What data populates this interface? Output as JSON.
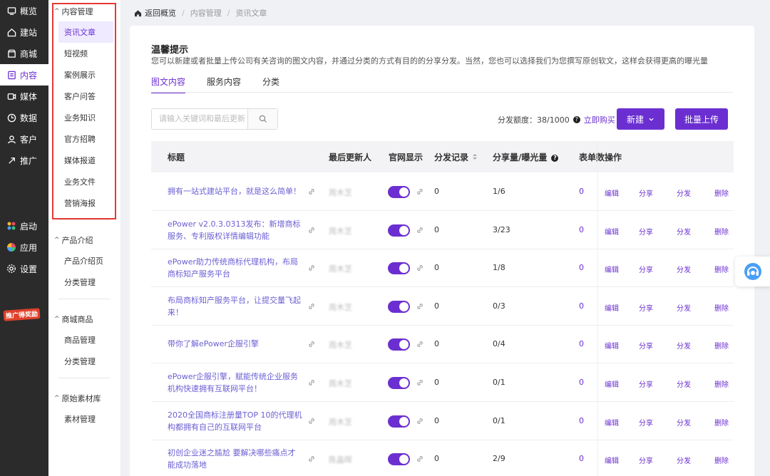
{
  "nav": {
    "items": [
      {
        "label": "概览",
        "icon": "overview-icon"
      },
      {
        "label": "建站",
        "icon": "home-icon"
      },
      {
        "label": "商城",
        "icon": "shop-icon"
      },
      {
        "label": "内容",
        "icon": "document-icon",
        "active": true
      },
      {
        "label": "媒体",
        "icon": "media-icon"
      },
      {
        "label": "数据",
        "icon": "data-icon"
      },
      {
        "label": "客户",
        "icon": "customer-icon"
      },
      {
        "label": "推广",
        "icon": "promote-icon"
      }
    ],
    "bottom": [
      {
        "label": "启动",
        "icon": "launch-icon"
      },
      {
        "label": "应用",
        "icon": "apps-icon"
      },
      {
        "label": "设置",
        "icon": "settings-icon"
      }
    ],
    "promo_label": "推广得奖励"
  },
  "sidebar": {
    "groups": [
      {
        "title": "内容管理",
        "items": [
          "资讯文章",
          "短视频",
          "案例展示",
          "客户问答",
          "业务知识",
          "官方招聘",
          "媒体报道",
          "业务文件",
          "营销海报"
        ]
      },
      {
        "title": "产品介绍",
        "items": [
          "产品介绍页",
          "分类管理"
        ]
      },
      {
        "title": "商城商品",
        "items": [
          "商品管理",
          "分类管理"
        ]
      },
      {
        "title": "原始素材库",
        "items": [
          "素材管理"
        ]
      }
    ]
  },
  "breadcrumb": {
    "back": "返回概览",
    "level1": "内容管理",
    "level2": "资讯文章"
  },
  "tip": {
    "title": "温馨提示",
    "text": "您可以新建或者批量上传公司有关咨询的图文内容，并通过分类的方式有目的的分享分发。当然，您也可以选择我们为您撰写原创软文，这样会获得更高的曝光量"
  },
  "tabs": [
    "图文内容",
    "服务内容",
    "分类"
  ],
  "search": {
    "placeholder": "请输入关键词和最后更新"
  },
  "quota": {
    "label": "分发额度：38/1000",
    "buy": "立即购买"
  },
  "buttons": {
    "new": "新建",
    "upload": "批量上传"
  },
  "table": {
    "headers": {
      "title": "标题",
      "user": "最后更新人",
      "display": "官网显示",
      "record": "分发记录",
      "share": "分享量/曝光量",
      "form": "表单数",
      "ops": "操作"
    },
    "ops": [
      "编辑",
      "分享",
      "分发",
      "删除"
    ],
    "rows": [
      {
        "title": "拥有一站式建站平台，就是这么简单！",
        "user": "周木芝",
        "record": "0",
        "share": "1/6",
        "form": "0"
      },
      {
        "title": "ePower v2.0.3.0313发布：新增商标服务、专利版权详情编辑功能",
        "user": "周木芝",
        "record": "0",
        "share": "3/23",
        "form": "0"
      },
      {
        "title": "ePower助力传统商标代理机构，布局商标知产服务平台",
        "user": "周木芝",
        "record": "0",
        "share": "1/8",
        "form": "0"
      },
      {
        "title": "布局商标知产服务平台，让提交量飞起来！",
        "user": "周木芝",
        "record": "0",
        "share": "0/3",
        "form": "0"
      },
      {
        "title": "带你了解ePower企服引擎",
        "user": "周木芝",
        "record": "0",
        "share": "0/4",
        "form": "0"
      },
      {
        "title": "ePower企服引擎，赋能传统企业服务机构快速拥有互联网平台！",
        "user": "周木芝",
        "record": "0",
        "share": "0/1",
        "form": "0"
      },
      {
        "title": "2020全国商标注册量TOP 10的代理机构都拥有自己的互联网平台",
        "user": "周木芝",
        "record": "0",
        "share": "0/1",
        "form": "0"
      },
      {
        "title": "初创企业迷之尴尬 要解决哪些痛点才能成功落地",
        "user": "陈晶晖",
        "record": "0",
        "share": "2/9",
        "form": "0"
      }
    ]
  },
  "colors": {
    "accent": "#6b2fd1",
    "nav_bg": "#2b2b2b",
    "highlight_box": "#e53935"
  }
}
